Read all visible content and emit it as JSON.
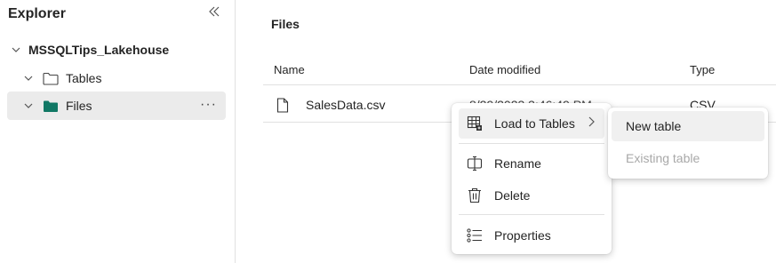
{
  "explorer": {
    "title": "Explorer",
    "collapse_icon": "double-chevron-left-icon",
    "lakehouse_name": "MSSQLTips_Lakehouse",
    "tables_label": "Tables",
    "files_label": "Files",
    "more_label": "···"
  },
  "main": {
    "title": "Files",
    "columns": [
      "Name",
      "Date modified",
      "Type"
    ],
    "rows": [
      {
        "name": "SalesData.csv",
        "date": "8/29/2023 3:46:49 PM",
        "type": "CSV"
      }
    ]
  },
  "context_menu": {
    "items": [
      {
        "label": "Load to Tables",
        "icon": "table-load-icon"
      },
      {
        "label": "Rename",
        "icon": "rename-icon"
      },
      {
        "label": "Delete",
        "icon": "trash-icon"
      },
      {
        "label": "Properties",
        "icon": "properties-icon"
      }
    ]
  },
  "submenu": {
    "items": [
      {
        "label": "New table",
        "enabled": true
      },
      {
        "label": "Existing table",
        "enabled": false
      }
    ]
  },
  "colors": {
    "folder_filled": "#117865",
    "hover_bg": "#ebebeb",
    "disabled_text": "#a8a8a8"
  }
}
